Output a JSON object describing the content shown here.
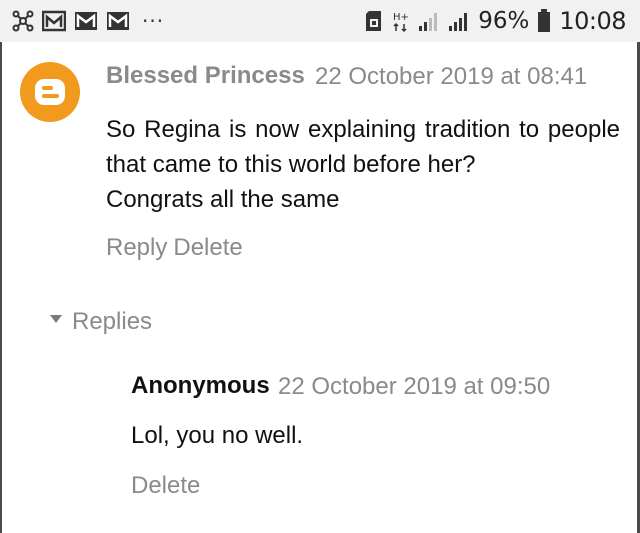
{
  "status_bar": {
    "icons_left": [
      "network-share-icon",
      "gallery-icon",
      "gmail-icon",
      "gmail-icon"
    ],
    "overflow": "···",
    "icons_right": [
      "sim-card-icon",
      "hplus-data-icon",
      "signal-bars-icon",
      "signal-bars-icon",
      "battery-icon"
    ],
    "battery": "96%",
    "time": "10:08"
  },
  "comment": {
    "author": "Blessed Princess",
    "timestamp": "22 October 2019 at 08:41",
    "text_line_1": "So Regina is now explaining tradition to people that came to this world before her?",
    "text_line_2": "Congrats all the same",
    "reply_label": "Reply",
    "delete_label": "Delete",
    "avatar_icon": "blogger-icon",
    "avatar_color": "#f29a1d"
  },
  "replies": {
    "toggle_label": "Replies",
    "items": [
      {
        "author": "Anonymous",
        "timestamp": "22 October 2019 at 09:50",
        "text": "Lol, you no well.",
        "delete_label": "Delete"
      }
    ]
  }
}
